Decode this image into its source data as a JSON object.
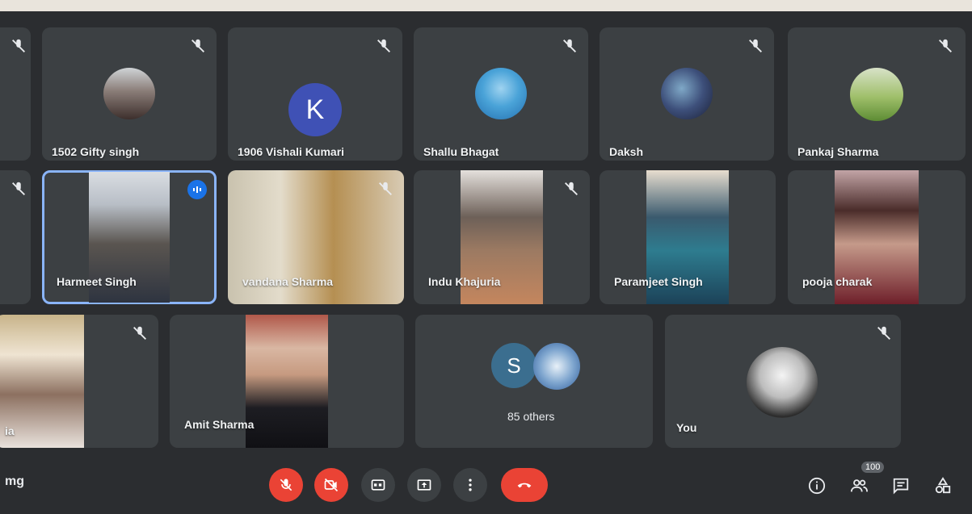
{
  "participants": [
    {
      "name": "1502 Gifty singh"
    },
    {
      "name": "1906 Vishali Kumari",
      "initial": "K"
    },
    {
      "name": "Shallu Bhagat"
    },
    {
      "name": "Daksh"
    },
    {
      "name": "Pankaj Sharma"
    },
    {
      "name": "Harmeet Singh"
    },
    {
      "name": "vandana Sharma"
    },
    {
      "name": "Indu Khajuria"
    },
    {
      "name": "Paramjeet Singh"
    },
    {
      "name": "pooja charak"
    },
    {
      "name": "ia"
    },
    {
      "name": "Amit Sharma"
    },
    {
      "name": "You"
    }
  ],
  "others": {
    "label": "85 others",
    "initial": "S"
  },
  "bottom_bar": {
    "meeting_code": "mg",
    "people_count": "100"
  },
  "icons": [
    "mic-off-icon",
    "videocam-off-icon",
    "closed-caption-icon",
    "present-screen-icon",
    "more-vert-icon",
    "call-end-icon",
    "info-icon",
    "people-icon",
    "chat-icon",
    "activities-icon"
  ],
  "colors": {
    "stage_bg": "#2b2d30",
    "tile_bg": "#3c4043",
    "danger": "#ea4335",
    "speaking_outline": "#8ab4f8",
    "avatar_k": "#3f51b5",
    "avatar_s": "#3b6e8f"
  }
}
